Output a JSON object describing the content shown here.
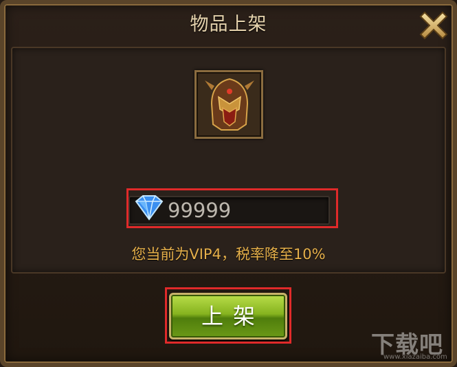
{
  "dialog": {
    "title": "物品上架"
  },
  "price": {
    "value": "99999",
    "currency_icon": "diamond-icon"
  },
  "tax_note": "您当前为VIP4，税率降至10%",
  "list_button_label": "上架",
  "watermark": {
    "text": "下载吧",
    "url": "www.xiazaiba.com"
  },
  "colors": {
    "title_text": "#e6d3ad",
    "note_text": "#e6b04a",
    "button_green": "#86b31f",
    "highlight_red": "#e02a2a"
  }
}
